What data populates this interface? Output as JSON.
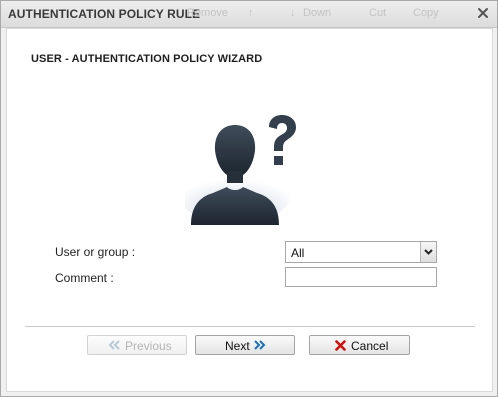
{
  "dialog": {
    "title": "AUTHENTICATION POLICY RULE",
    "background_toolbar": [
      "Remove",
      "Down",
      "Cut",
      "Copy"
    ]
  },
  "wizard": {
    "title": "USER - AUTHENTICATION POLICY WIZARD",
    "illustration_icon": "user-unknown-icon"
  },
  "form": {
    "user_or_group_label": "User or group :",
    "user_or_group_value": "All",
    "comment_label": "Comment :",
    "comment_value": ""
  },
  "buttons": {
    "previous_label": "Previous",
    "next_label": "Next",
    "cancel_label": "Cancel"
  },
  "colors": {
    "accent_blue": "#1f6fb5",
    "cancel_red": "#cc1111",
    "disabled_text": "#b4b4b4",
    "avatar_dark": "#2a3440"
  }
}
